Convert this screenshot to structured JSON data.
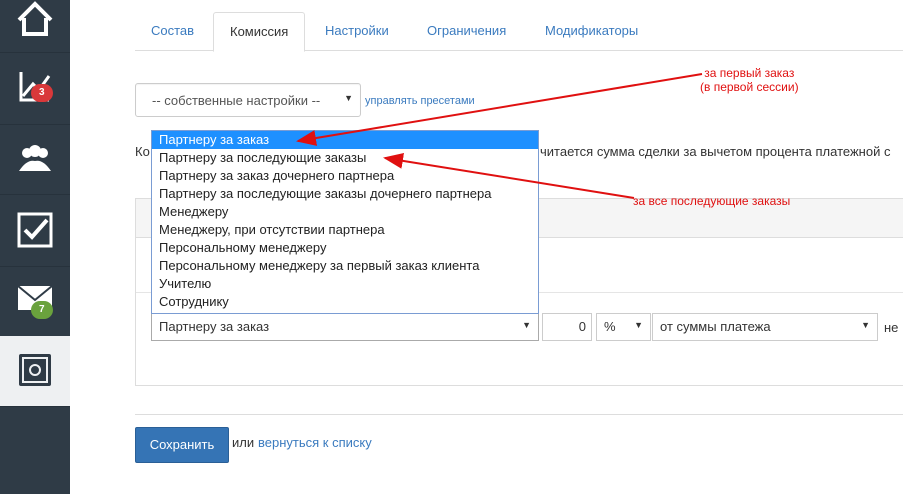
{
  "sidebar": {
    "items": [
      {
        "icon": "home-icon"
      },
      {
        "icon": "chart-trend-icon",
        "badge": "3",
        "badge_color": "#d9383a"
      },
      {
        "icon": "users-group-icon"
      },
      {
        "icon": "checkbox-icon"
      },
      {
        "icon": "mail-icon",
        "badge": "7",
        "badge_color": "#6aa23d"
      },
      {
        "icon": "safe-icon",
        "active": true
      }
    ]
  },
  "tabs": [
    "Состав",
    "Комиссия",
    "Настройки",
    "Ограничения",
    "Модификаторы"
  ],
  "active_tab": "Комиссия",
  "preset": {
    "value": "-- собственные настройки --",
    "manage_link": "управлять пресетами"
  },
  "description": {
    "left_fragment": "Ко",
    "right_fragment": "читается сумма сделки за вычетом процента платежной с"
  },
  "recipient_options": [
    "Партнеру за заказ",
    "Партнеру за последующие заказы",
    "Партнеру за заказ дочернего партнера",
    "Партнеру за последующие заказы дочернего партнера",
    "Менеджеру",
    "Менеджеру, при отсутствии партнера",
    "Персональному менеджеру",
    "Персональному менеджеру за первый заказ клиента",
    "Учителю",
    "Сотруднику"
  ],
  "rule": {
    "recipient": "Партнеру за заказ",
    "amount": "0",
    "unit": "%",
    "base": "от суммы платежа",
    "trailing": "не"
  },
  "footer": {
    "save": "Сохранить",
    "or": "или",
    "back": "вернуться к списку"
  },
  "annotations": {
    "first_line1": "за первый заказ",
    "first_line2": "(в первой сессии)",
    "subsequent": "за все последующие заказы",
    "color": "#e01010"
  },
  "colors": {
    "sidebar": "#2f3b46",
    "link": "#3b7bbf",
    "primary_button": "#3574b5",
    "dropdown_highlight": "#1e90ff"
  }
}
